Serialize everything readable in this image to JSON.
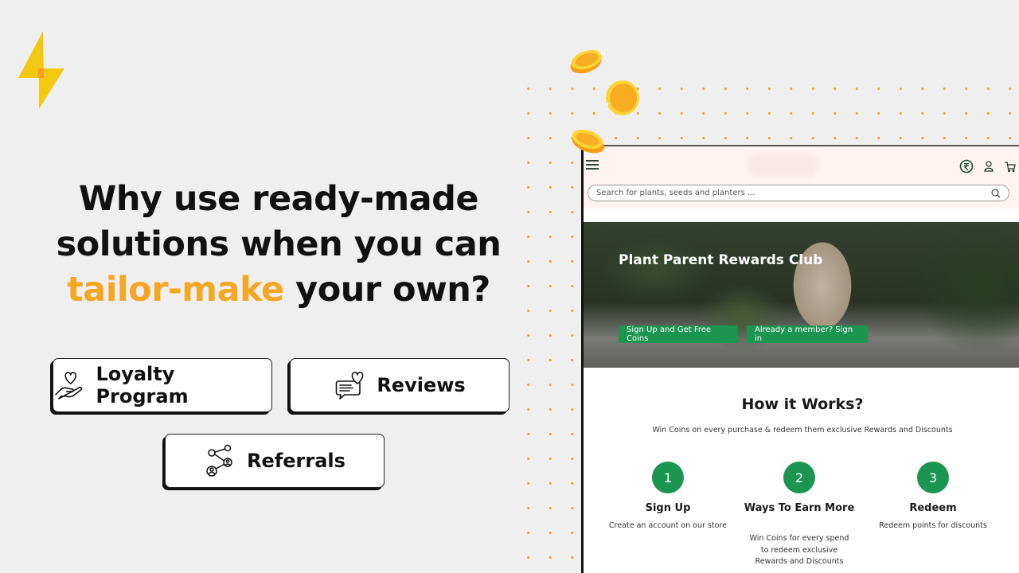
{
  "headline": {
    "line1": "Why use ready-made",
    "line2": "solutions when you can",
    "accent": "tailor-make",
    "line3_rest": " your own?"
  },
  "features": [
    {
      "label": "Loyalty Program",
      "icon": "heart-hand-icon"
    },
    {
      "label": "Reviews",
      "icon": "chat-heart-icon"
    },
    {
      "label": "Referrals",
      "icon": "referral-network-icon"
    }
  ],
  "colors": {
    "accent": "#f5a623",
    "bolt": "#f2c811",
    "brand_green": "#1b9550",
    "background": "#efefef",
    "store_header": "#fdf3f1"
  },
  "store": {
    "search_placeholder": "Search for plants, seeds and planters ...",
    "header_icons": [
      "rupee-coin-icon",
      "user-icon",
      "cart-icon"
    ],
    "hero": {
      "title": "Plant Parent Rewards Club",
      "signup_button": "Sign Up and Get Free Coins",
      "signin_button": "Already a member? Sign in"
    },
    "how_it_works": {
      "title": "How it Works?",
      "subtitle": "Win Coins on every purchase & redeem them exclusive Rewards and Discounts",
      "steps": [
        {
          "number": "1",
          "title": "Sign Up",
          "description": "Create an account on our store"
        },
        {
          "number": "2",
          "title": "Ways To Earn More",
          "description": "Win Coins for every spend to redeem exclusive Rewards and Discounts"
        },
        {
          "number": "3",
          "title": "Redeem",
          "description": "Redeem points for discounts"
        }
      ]
    }
  }
}
